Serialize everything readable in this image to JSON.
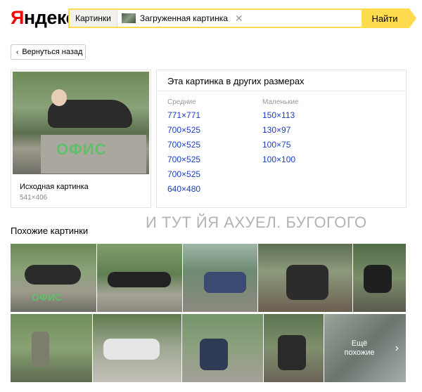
{
  "header": {
    "logo_first": "Я",
    "logo_rest": "ндекс",
    "search_tab": "Картинки",
    "search_chip": "Загруженная картинка",
    "search_button": "Найти"
  },
  "back_button": "Вернуться назад",
  "original": {
    "label": "Исходная картинка",
    "size": "541×406",
    "image_text": "ОФИС"
  },
  "other_sizes": {
    "title": "Эта картинка в других размерах",
    "medium_header": "Средние",
    "small_header": "Маленькие",
    "medium": [
      "771×771",
      "700×525",
      "700×525",
      "700×525",
      "700×525",
      "640×480"
    ],
    "small": [
      "150×113",
      "130×97",
      "100×75",
      "100×100"
    ]
  },
  "overlay_caption": "И ТУТ ЙЯ АХУЕЛ. БУГОГОГО",
  "similar": {
    "title": "Похожие картинки",
    "more_line1": "Ещё",
    "more_line2": "похожие"
  },
  "colors": {
    "logo_red": "#ff0000",
    "search_yellow": "#ffdb4d",
    "link_blue": "#1a3dc1"
  }
}
